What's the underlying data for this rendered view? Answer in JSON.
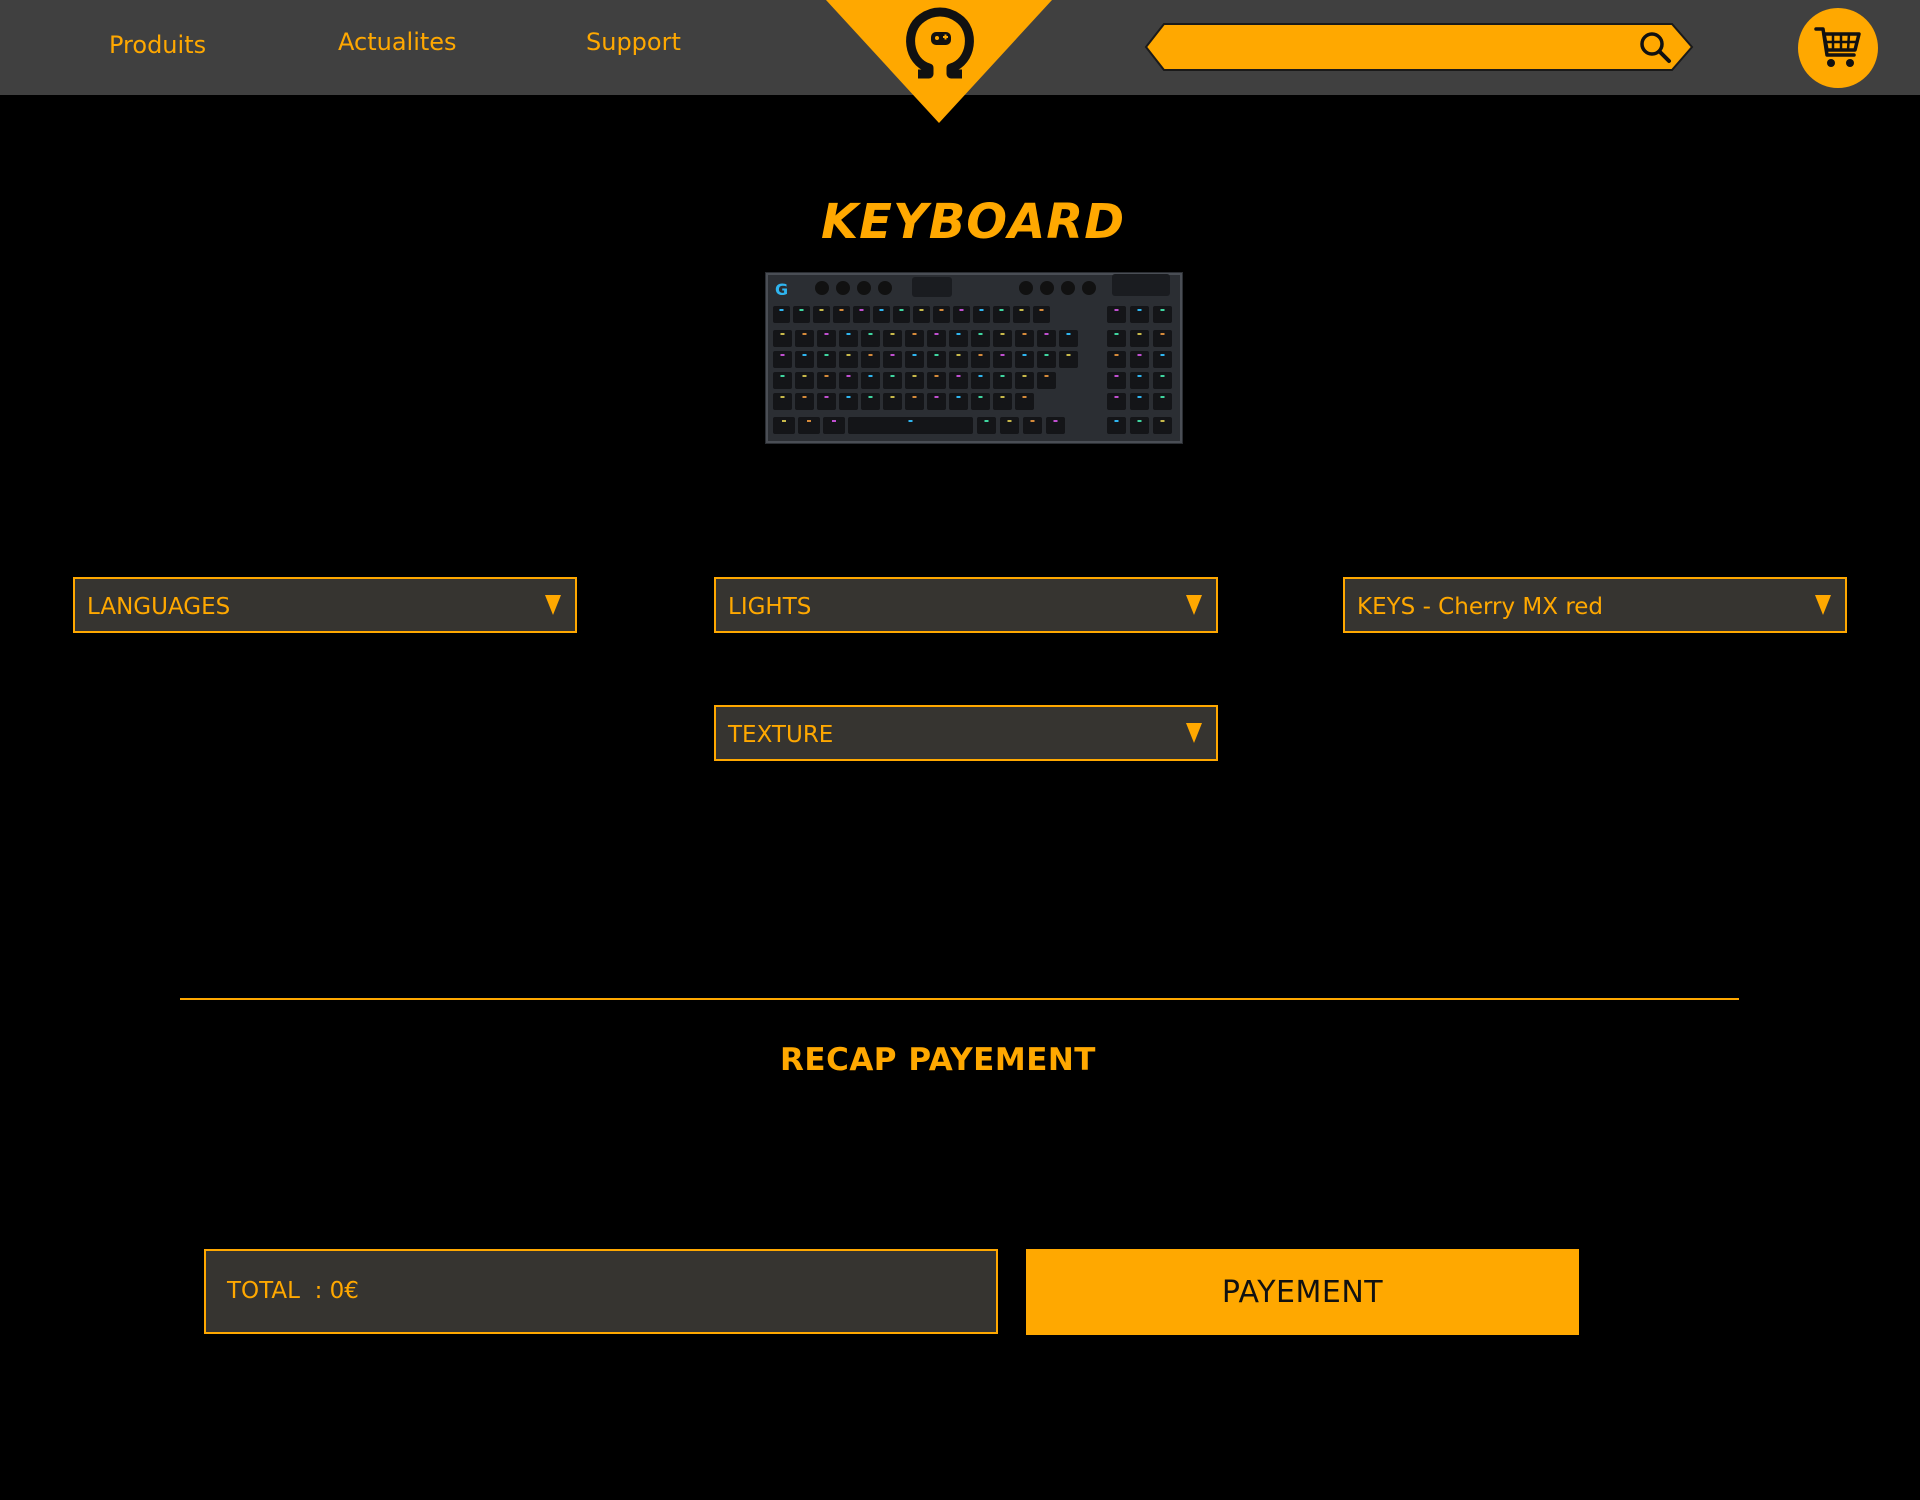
{
  "colors": {
    "accent": "#ffa800",
    "topbar": "#404040",
    "background": "#000000",
    "field_background": "#363430"
  },
  "nav": {
    "items": [
      {
        "label": "Produits"
      },
      {
        "label": "Actualites"
      },
      {
        "label": "Support"
      }
    ]
  },
  "logo": {
    "icon": "omega-gamepad-logo"
  },
  "search": {
    "value": "",
    "placeholder": "",
    "icon": "search-icon"
  },
  "cart": {
    "icon": "cart-icon"
  },
  "product": {
    "title": "KEYBOARD",
    "image": "keyboard-product-image"
  },
  "options": {
    "languages": "LANGUAGES",
    "lights": "LIGHTS",
    "keys": "KEYS - Cherry MX red",
    "texture": "TEXTURE"
  },
  "recap": {
    "title": "RECAP PAYEMENT",
    "total": "TOTAL  : 0€",
    "pay_button": "PAYEMENT"
  }
}
